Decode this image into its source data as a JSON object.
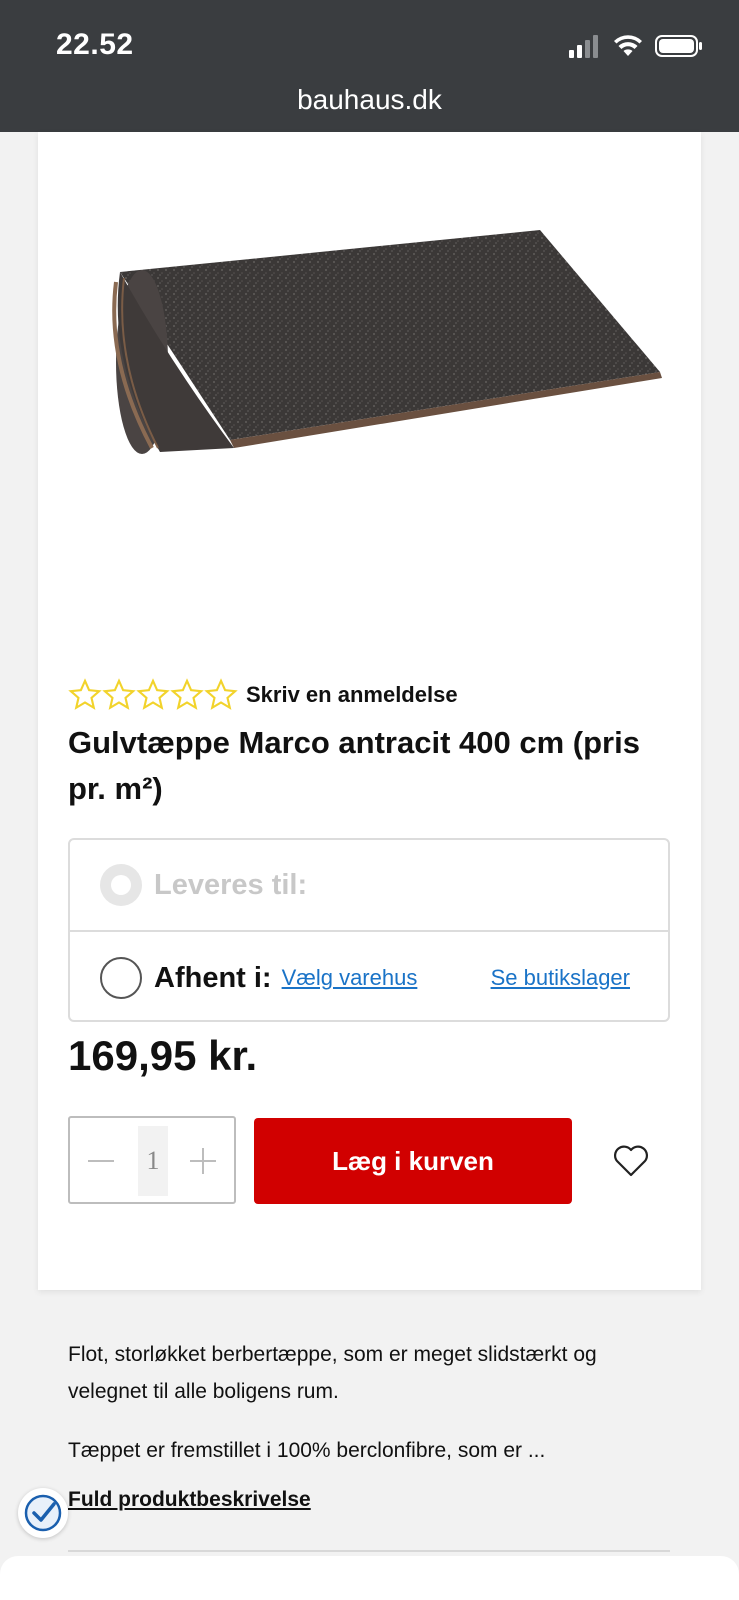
{
  "status_bar": {
    "time": "22.52",
    "url": "bauhaus.dk"
  },
  "product": {
    "image_icon": "carpet-roll",
    "rating_stars": 5,
    "rating_value": 0,
    "review_link": "Skriv en anmeldelse",
    "title": "Gulvtæppe Marco antracit 400 cm (pris pr. m²)",
    "price": "169,95 kr."
  },
  "delivery": {
    "ship_label": "Leveres til:",
    "pickup_label": "Afhent i:",
    "choose_store_link": "Vælg varehus",
    "stock_link": "Se butikslager"
  },
  "cart": {
    "quantity": "1",
    "add_to_cart": "Læg i kurven"
  },
  "description": {
    "line1": "Flot, storløkket berbertæppe, som er meget slidstærkt og velegnet til alle boligens rum.",
    "line2": "Tæppet er fremstillet i 100% berclonfibre, som er ...",
    "full_link": "Fuld produktbeskrivelse"
  },
  "colors": {
    "accent_red": "#d10000",
    "link_blue": "#1a73c7",
    "star_yellow": "#f2d32b",
    "status_bar_bg": "#3a3d40"
  }
}
